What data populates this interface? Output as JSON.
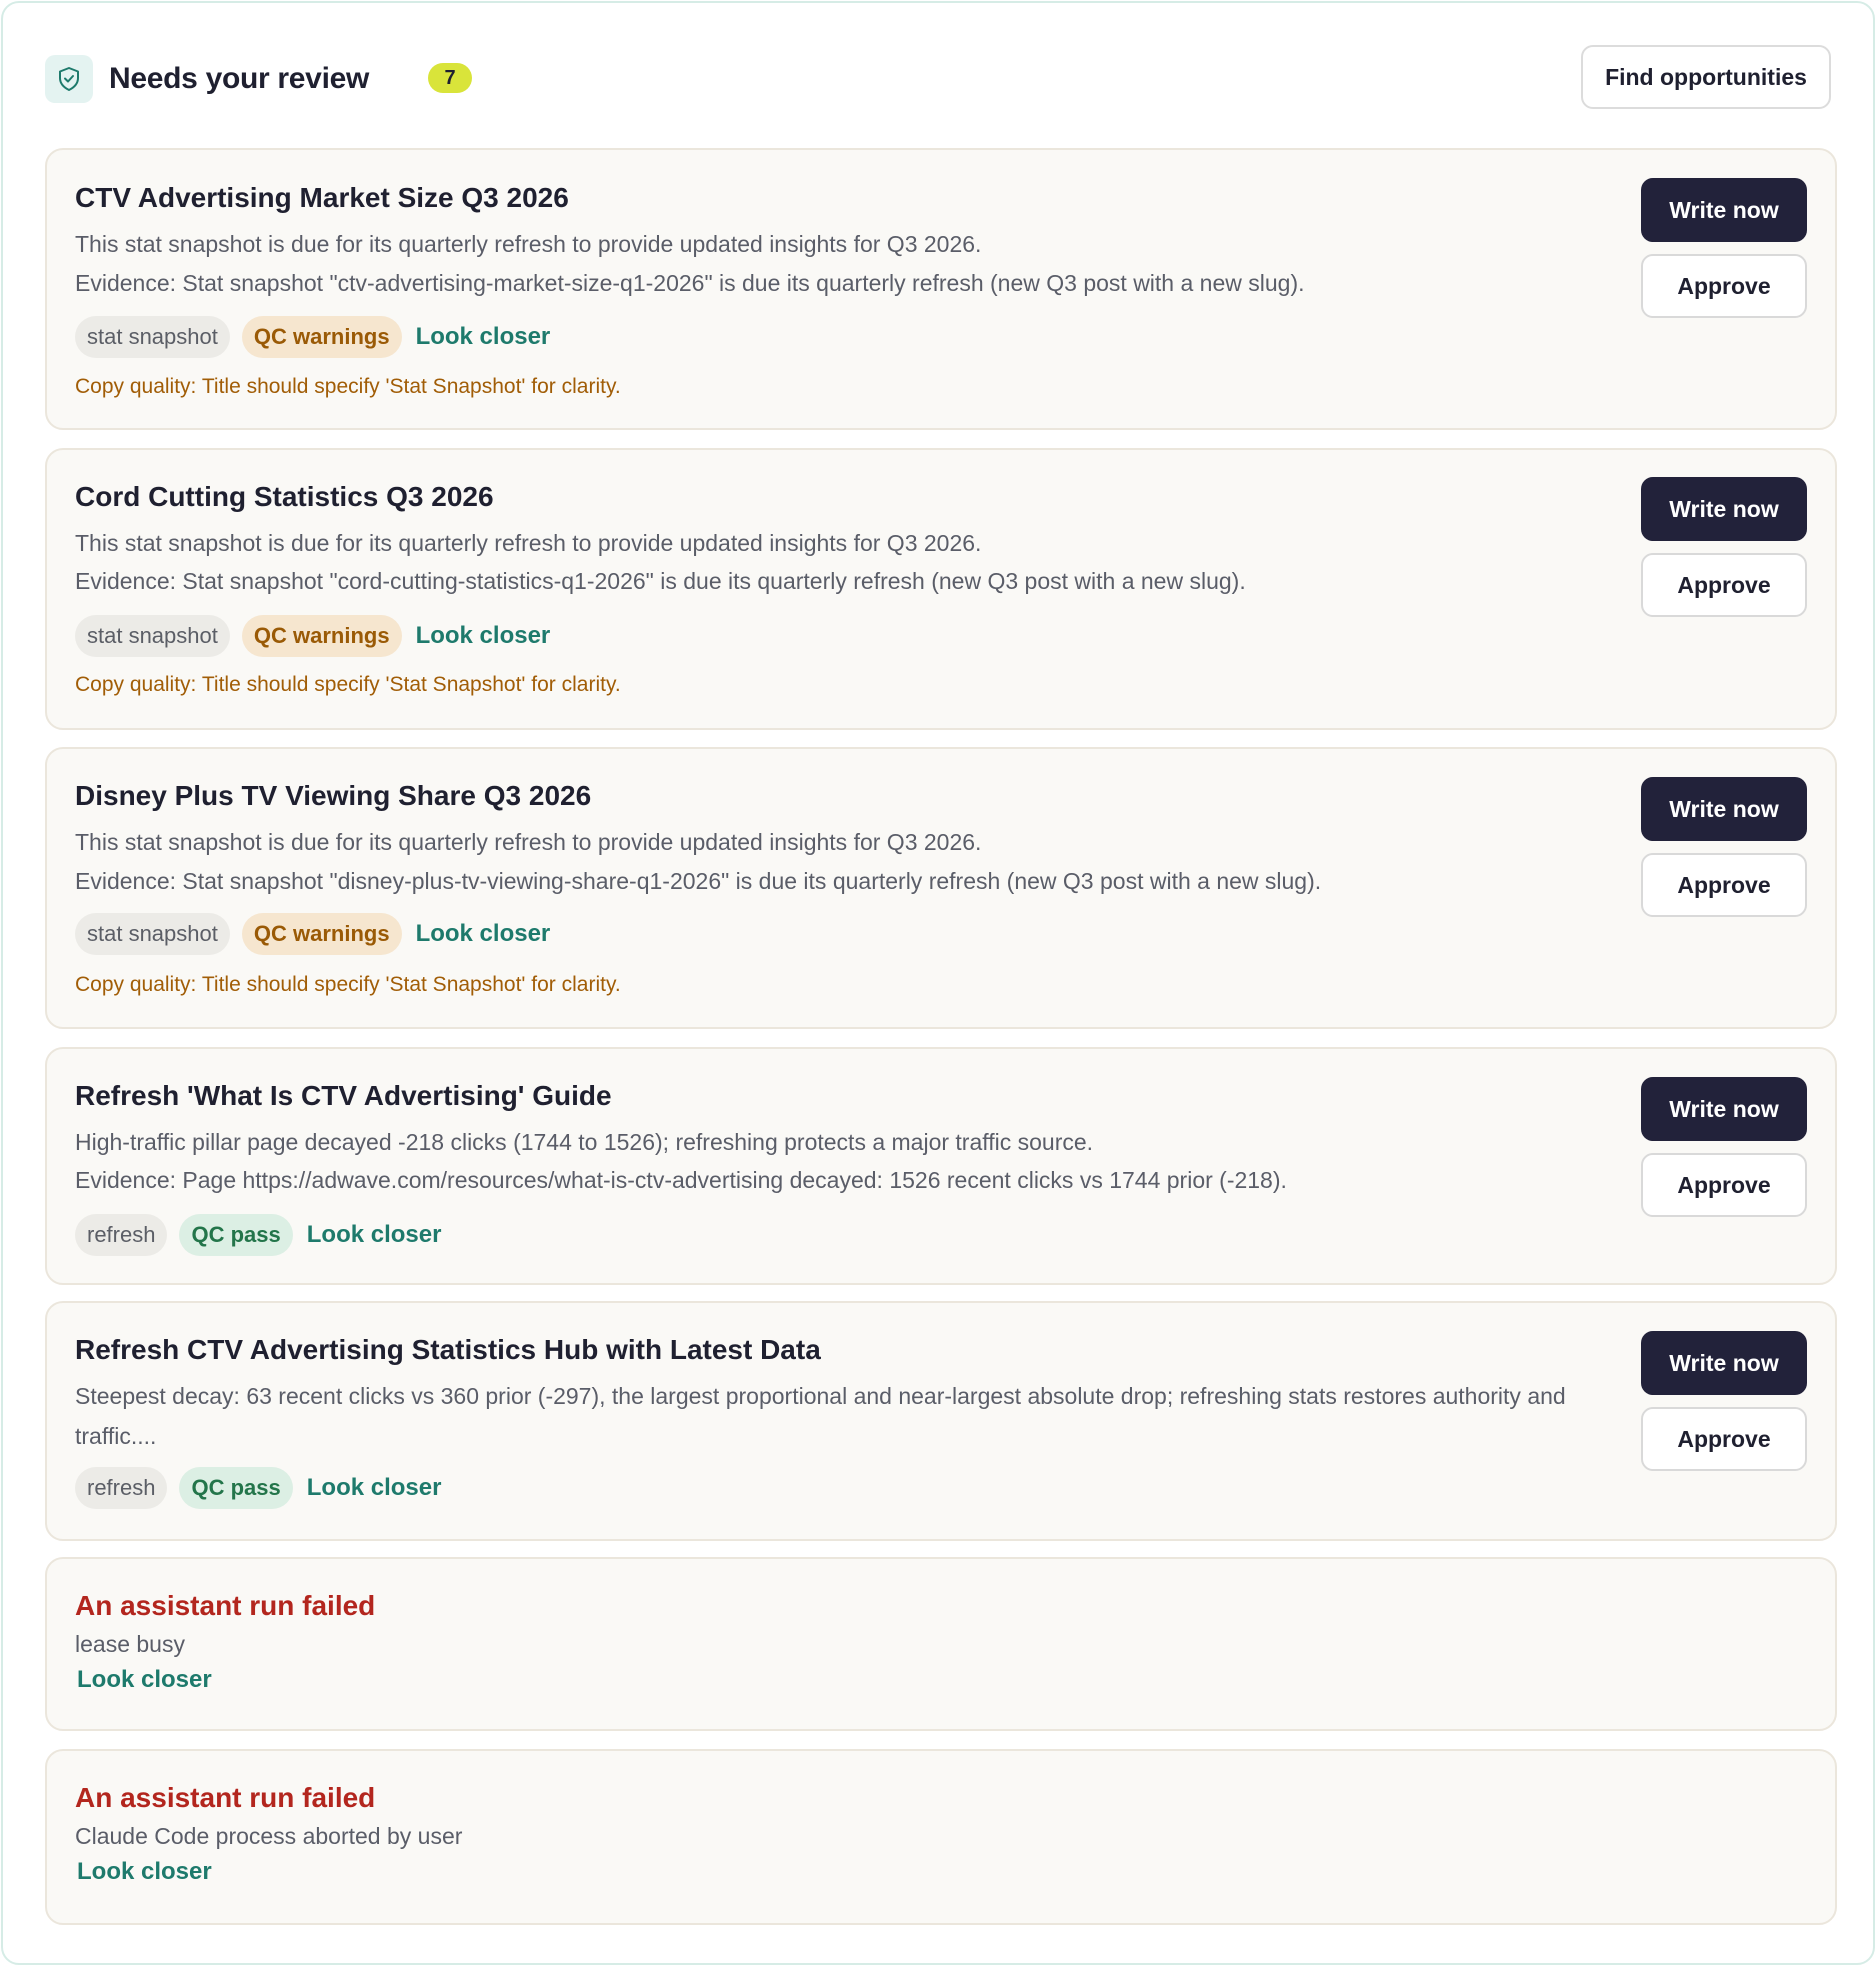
{
  "header": {
    "title": "Needs your review",
    "count": "7",
    "find_button": "Find opportunities"
  },
  "cards": [
    {
      "title": "CTV Advertising Market Size Q3 2026",
      "summary": "This stat snapshot is due for its quarterly refresh to provide updated insights for Q3 2026.",
      "evidence": "Evidence: Stat snapshot \"ctv-advertising-market-size-q1-2026\" is due its quarterly refresh (new Q3 post with a new slug).",
      "kind_tag": "stat snapshot",
      "qc_tag": "QC warnings",
      "look_closer": "Look closer",
      "qc_note": "Copy quality: Title should specify 'Stat Snapshot' for clarity.",
      "write_label": "Write now",
      "approve_label": "Approve"
    },
    {
      "title": "Cord Cutting Statistics Q3 2026",
      "summary": "This stat snapshot is due for its quarterly refresh to provide updated insights for Q3 2026.",
      "evidence": "Evidence: Stat snapshot \"cord-cutting-statistics-q1-2026\" is due its quarterly refresh (new Q3 post with a new slug).",
      "kind_tag": "stat snapshot",
      "qc_tag": "QC warnings",
      "look_closer": "Look closer",
      "qc_note": "Copy quality: Title should specify 'Stat Snapshot' for clarity.",
      "write_label": "Write now",
      "approve_label": "Approve"
    },
    {
      "title": "Disney Plus TV Viewing Share Q3 2026",
      "summary": "This stat snapshot is due for its quarterly refresh to provide updated insights for Q3 2026.",
      "evidence": "Evidence: Stat snapshot \"disney-plus-tv-viewing-share-q1-2026\" is due its quarterly refresh (new Q3 post with a new slug).",
      "kind_tag": "stat snapshot",
      "qc_tag": "QC warnings",
      "look_closer": "Look closer",
      "qc_note": "Copy quality: Title should specify 'Stat Snapshot' for clarity.",
      "write_label": "Write now",
      "approve_label": "Approve"
    },
    {
      "title": "Refresh 'What Is CTV Advertising' Guide",
      "summary": "High-traffic pillar page decayed -218 clicks (1744 to 1526); refreshing protects a major traffic source.",
      "evidence": "Evidence: Page https://adwave.com/resources/what-is-ctv-advertising decayed: 1526 recent clicks vs 1744 prior (-218).",
      "kind_tag": "refresh",
      "qc_tag": "QC pass",
      "look_closer": "Look closer",
      "write_label": "Write now",
      "approve_label": "Approve"
    },
    {
      "title": "Refresh CTV Advertising Statistics Hub with Latest Data",
      "summary": "Steepest decay: 63 recent clicks vs 360 prior (-297), the largest proportional and near-largest absolute drop; refreshing stats restores authority and traffic....",
      "kind_tag": "refresh",
      "qc_tag": "QC pass",
      "look_closer": "Look closer",
      "write_label": "Write now",
      "approve_label": "Approve"
    }
  ],
  "failures": [
    {
      "title": "An assistant run failed",
      "message": "lease busy",
      "look_closer": "Look closer"
    },
    {
      "title": "An assistant run failed",
      "message": "Claude Code process aborted by user",
      "look_closer": "Look closer"
    }
  ],
  "colors": {
    "accent_teal": "#1e7a6c",
    "badge_yellow": "#d9e43a",
    "primary_button": "#22223a",
    "warning": "#a15d07",
    "error": "#b3261e"
  }
}
